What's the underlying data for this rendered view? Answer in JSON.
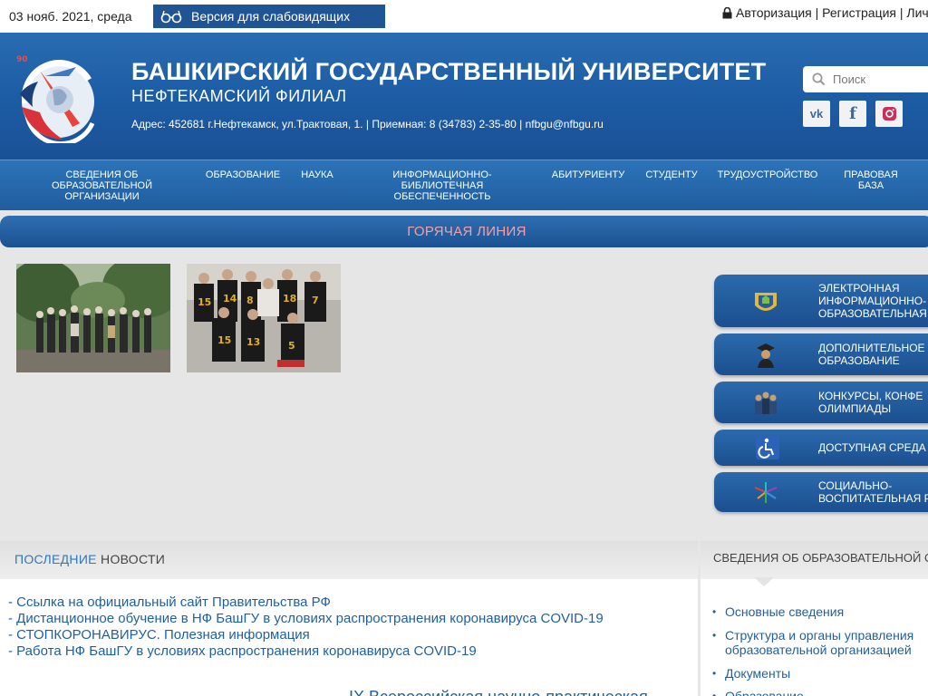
{
  "topbar": {
    "date": "03 нояб. 2021, среда",
    "vision_label": "Версия для слабовидящих",
    "auth_text": "Авторизация  | Регистрация | Лич"
  },
  "header": {
    "title": "БАШКИРСКИЙ ГОСУДАРСТВЕННЫЙ УНИВЕРСИТЕТ",
    "subtitle": "НЕФТЕКАМСКИЙ ФИЛИАЛ",
    "address": "Адрес: 452681 г.Нефтекамск, ул.Трактовая, 1. | Приемная: 8 (34783) 2-35-80 | nfbgu@nfbgu.ru",
    "search_placeholder": "Поиск",
    "social": {
      "vk": "vk",
      "fb": "f"
    }
  },
  "nav": {
    "items": [
      "СВЕДЕНИЯ ОБ ОБРАЗОВАТЕЛЬНОЙ ОРГАНИЗАЦИИ",
      "ОБРАЗОВАНИЕ",
      "НАУКА",
      "ИНФОРМАЦИОННО-БИБЛИОТЕЧНАЯ ОБЕСПЕЧЕННОСТЬ",
      "АБИТУРИЕНТУ",
      "СТУДЕНТУ",
      "ТРУДОУСТРОЙСТВО",
      "ПРАВОВАЯ БАЗА"
    ]
  },
  "hotline": "ГОРЯЧАЯ ЛИНИЯ",
  "side_buttons": [
    "ЭЛЕКТРОННАЯ\nИНФОРМАЦИОННО-\nОБРАЗОВАТЕЛЬНАЯ",
    "ДОПОЛНИТЕЛЬНОЕ\nОБРАЗОВАНИЕ",
    "КОНКУРСЫ, КОНФЕ\nОЛИМПИАДЫ",
    "ДОСТУПНАЯ СРЕДА",
    "СОЦИАЛЬНО-\nВОСПИТАТЕЛЬНАЯ Р"
  ],
  "news": {
    "heading_part1": "ПОСЛЕДНИЕ",
    "heading_part2": "НОВОСТИ",
    "items": [
      "- Ссылка на официальный сайт Правительства РФ",
      "- Дистанционное обучение в НФ БашГУ в условиях распространения коронавируса COVID-19",
      "- СТОПКОРОНАВИРУС. Полезная информация",
      "- Работа НФ БашГУ в условиях распространения коронавируса COVID-19"
    ],
    "more_title": "IX Всероссийская научно-практическая"
  },
  "info": {
    "heading": "СВЕДЕНИЯ ОБ ОБРАЗОВАТЕЛЬНОЙ О",
    "items": [
      "Основные сведения",
      "Структура и органы управления образовательной организацией",
      "Документы",
      "Образование"
    ]
  },
  "colors": {
    "header_blue": "#1d5ea6",
    "hotline_text": "#f2a0a8",
    "link_blue": "#1f5f9f"
  }
}
